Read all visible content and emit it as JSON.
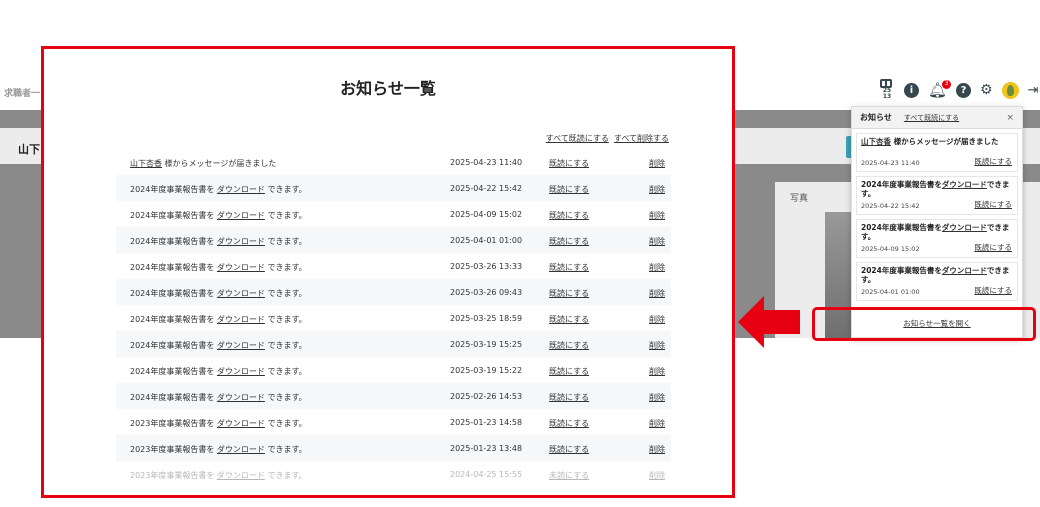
{
  "background": {
    "left_label": "求職者一",
    "name_label": "山下",
    "card_label": "写真"
  },
  "header": {
    "calendar_text": "25/\n13",
    "notification_count": "3"
  },
  "dropdown": {
    "title": "お知らせ",
    "mark_all_read": "すべて既読にする",
    "close": "×",
    "items": [
      {
        "pre": "",
        "link": "山下杏香",
        "post": " 様からメッセージが届きました",
        "date": "2025-04-23 11:40",
        "action": "既読にする"
      },
      {
        "pre": "2024年度事業報告書を",
        "link": "ダウンロード",
        "post": "できます。",
        "date": "2025-04-22 15:42",
        "action": "既読にする"
      },
      {
        "pre": "2024年度事業報告書を",
        "link": "ダウンロード",
        "post": "できます。",
        "date": "2025-04-09 15:02",
        "action": "既読にする"
      },
      {
        "pre": "2024年度事業報告書を",
        "link": "ダウンロード",
        "post": "できます。",
        "date": "2025-04-01 01:00",
        "action": "既読にする"
      }
    ],
    "footer_link": "お知らせ一覧を開く"
  },
  "list": {
    "title": "お知らせ一覧",
    "mark_all_read": "すべて既読にする",
    "delete_all": "すべて削除する",
    "rows": [
      {
        "pre": "",
        "link": "山下杏香",
        "post": " 様からメッセージが届きました",
        "date": "2025-04-23 11:40",
        "read": "既読にする",
        "del": "削除"
      },
      {
        "pre": "2024年度事業報告書を ",
        "link": "ダウンロード",
        "post": " できます。",
        "date": "2025-04-22 15:42",
        "read": "既読にする",
        "del": "削除"
      },
      {
        "pre": "2024年度事業報告書を ",
        "link": "ダウンロード",
        "post": " できます。",
        "date": "2025-04-09 15:02",
        "read": "既読にする",
        "del": "削除"
      },
      {
        "pre": "2024年度事業報告書を ",
        "link": "ダウンロード",
        "post": " できます。",
        "date": "2025-04-01 01:00",
        "read": "既読にする",
        "del": "削除"
      },
      {
        "pre": "2024年度事業報告書を ",
        "link": "ダウンロード",
        "post": " できます。",
        "date": "2025-03-26 13:33",
        "read": "既読にする",
        "del": "削除"
      },
      {
        "pre": "2024年度事業報告書を ",
        "link": "ダウンロード",
        "post": " できます。",
        "date": "2025-03-26 09:43",
        "read": "既読にする",
        "del": "削除"
      },
      {
        "pre": "2024年度事業報告書を ",
        "link": "ダウンロード",
        "post": " できます。",
        "date": "2025-03-25 18:59",
        "read": "既読にする",
        "del": "削除"
      },
      {
        "pre": "2024年度事業報告書を ",
        "link": "ダウンロード",
        "post": " できます。",
        "date": "2025-03-19 15:25",
        "read": "既読にする",
        "del": "削除"
      },
      {
        "pre": "2024年度事業報告書を ",
        "link": "ダウンロード",
        "post": " できます。",
        "date": "2025-03-19 15:22",
        "read": "既読にする",
        "del": "削除"
      },
      {
        "pre": "2024年度事業報告書を ",
        "link": "ダウンロード",
        "post": " できます。",
        "date": "2025-02-26 14:53",
        "read": "既読にする",
        "del": "削除"
      },
      {
        "pre": "2023年度事業報告書を ",
        "link": "ダウンロード",
        "post": " できます。",
        "date": "2025-01-23 14:58",
        "read": "既読にする",
        "del": "削除"
      },
      {
        "pre": "2023年度事業報告書を ",
        "link": "ダウンロード",
        "post": " できます。",
        "date": "2025-01-23 13:48",
        "read": "既読にする",
        "del": "削除"
      },
      {
        "pre": "2023年度事業報告書を ",
        "link": "ダウンロード",
        "post": " できます。",
        "date": "2024-04-25 15:55",
        "read": "未読にする",
        "del": "削除"
      }
    ]
  },
  "colors": {
    "highlight": "#e60012",
    "icon": "#37474f"
  }
}
